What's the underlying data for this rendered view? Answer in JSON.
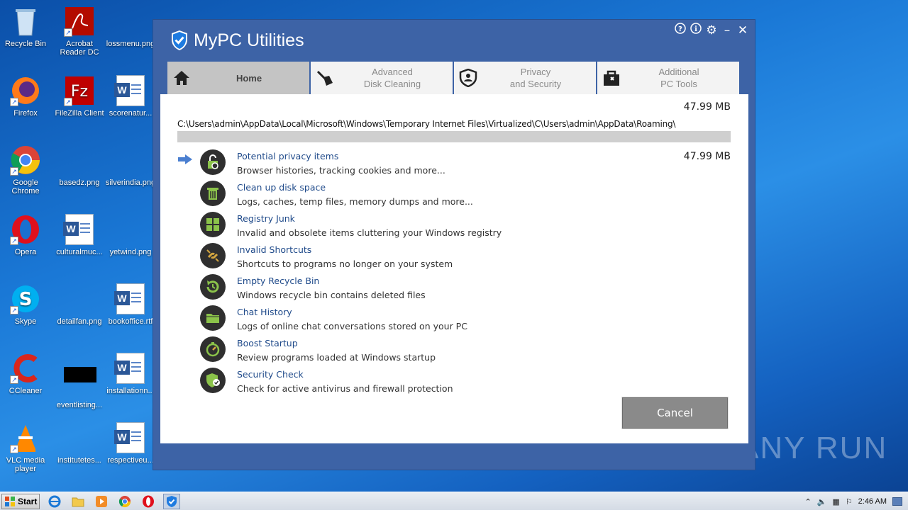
{
  "desktop": {
    "icons": [
      {
        "label": "Recycle Bin",
        "icon": "recycle-bin-icon"
      },
      {
        "label": "Acrobat Reader DC",
        "icon": "acrobat-icon"
      },
      {
        "label": "lossmenu.png",
        "icon": "image-file-icon"
      },
      {
        "label": "Firefox",
        "icon": "firefox-icon"
      },
      {
        "label": "FileZilla Client",
        "icon": "filezilla-icon"
      },
      {
        "label": "scorenatur...",
        "icon": "word-doc-icon"
      },
      {
        "label": "Google Chrome",
        "icon": "chrome-icon"
      },
      {
        "label": "basedz.png",
        "icon": "image-file-icon"
      },
      {
        "label": "silverindia.png",
        "icon": "image-file-icon"
      },
      {
        "label": "Opera",
        "icon": "opera-icon"
      },
      {
        "label": "culturalmuc...",
        "icon": "word-doc-icon"
      },
      {
        "label": "yetwind.png",
        "icon": "image-file-icon"
      },
      {
        "label": "Skype",
        "icon": "skype-icon"
      },
      {
        "label": "detailfan.png",
        "icon": "image-file-icon"
      },
      {
        "label": "bookoffice.rtf",
        "icon": "word-doc-icon"
      },
      {
        "label": "CCleaner",
        "icon": "ccleaner-icon"
      },
      {
        "label": "eventlisting...",
        "icon": "image-file-icon"
      },
      {
        "label": "installationn...",
        "icon": "word-doc-icon"
      },
      {
        "label": "VLC media player",
        "icon": "vlc-icon"
      },
      {
        "label": "institutetes...",
        "icon": "image-file-icon"
      },
      {
        "label": "respectiveu...",
        "icon": "word-doc-icon"
      }
    ]
  },
  "window": {
    "title": "MyPC Utilities",
    "controls": {
      "help": "?",
      "info": "i",
      "settings": "⚙",
      "minimize": "–",
      "close": "✕"
    },
    "tabs": [
      {
        "label": "Home",
        "icon": "home-icon",
        "active": true
      },
      {
        "label": "Advanced\nDisk Cleaning",
        "icon": "broom-icon",
        "active": false
      },
      {
        "label": "Privacy\nand Security",
        "icon": "privacy-shield-icon",
        "active": false
      },
      {
        "label": "Additional\nPC Tools",
        "icon": "toolbox-icon",
        "active": false
      }
    ],
    "scan": {
      "total_size": "47.99 MB",
      "current_path": "C:\\Users\\admin\\AppData\\Local\\Microsoft\\Windows\\Temporary Internet Files\\Virtualized\\C\\Users\\admin\\AppData\\Roaming\\",
      "progress": 1.0
    },
    "items": [
      {
        "title": "Potential privacy items",
        "desc": "Browser histories, tracking cookies and more...",
        "amount": "47.99 MB",
        "current": true,
        "icon": "privacy-lock-icon"
      },
      {
        "title": "Clean up disk space",
        "desc": "Logs, caches, temp files, memory dumps and more...",
        "amount": "",
        "current": false,
        "icon": "trash-icon"
      },
      {
        "title": "Registry Junk",
        "desc": "Invalid and obsolete items cluttering your Windows registry",
        "amount": "",
        "current": false,
        "icon": "windows-logo-icon"
      },
      {
        "title": "Invalid Shortcuts",
        "desc": "Shortcuts to programs no longer on your system",
        "amount": "",
        "current": false,
        "icon": "broken-link-icon"
      },
      {
        "title": "Empty Recycle Bin",
        "desc": "Windows recycle bin contains deleted files",
        "amount": "",
        "current": false,
        "icon": "recycle-icon"
      },
      {
        "title": "Chat History",
        "desc": "Logs of online chat conversations stored on your PC",
        "amount": "",
        "current": false,
        "icon": "folder-icon"
      },
      {
        "title": "Boost Startup",
        "desc": "Review programs loaded at Windows startup",
        "amount": "",
        "current": false,
        "icon": "stopwatch-icon"
      },
      {
        "title": "Security Check",
        "desc": "Check for active antivirus and firewall protection",
        "amount": "",
        "current": false,
        "icon": "shield-check-icon"
      }
    ],
    "cancel_label": "Cancel"
  },
  "taskbar": {
    "start_label": "Start",
    "pinned": [
      "ie-icon",
      "explorer-icon",
      "media-player-icon",
      "chrome-icon",
      "opera-icon",
      "mypc-utilities-icon"
    ],
    "clock": "2:46 AM"
  },
  "watermark": "ANY RUN",
  "colors": {
    "accent": "#3d63a6",
    "link": "#1f4a8a",
    "icon_green": "#8bc34a"
  }
}
